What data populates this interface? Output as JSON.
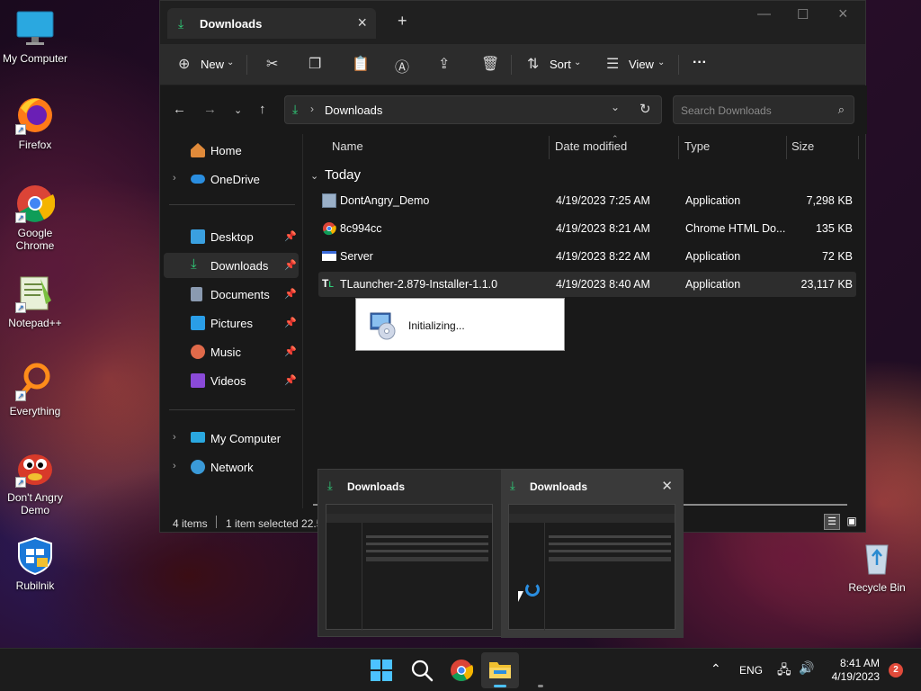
{
  "desktop": {
    "icons": [
      {
        "label": "My Computer"
      },
      {
        "label": "Firefox"
      },
      {
        "label": "Google Chrome"
      },
      {
        "label": "Notepad++"
      },
      {
        "label": "Everything"
      },
      {
        "label": "Don't Angry Demo"
      },
      {
        "label": "Rubilnik"
      },
      {
        "label": "Recycle Bin"
      }
    ]
  },
  "explorer": {
    "tab_title": "Downloads",
    "new_tab": "+",
    "toolbar": {
      "new_label": "New",
      "sort_label": "Sort",
      "view_label": "View",
      "more": "···"
    },
    "address": {
      "path": "Downloads"
    },
    "search": {
      "placeholder": "Search Downloads"
    },
    "sidebar": {
      "home": "Home",
      "onedrive": "OneDrive",
      "desktop": "Desktop",
      "downloads": "Downloads",
      "documents": "Documents",
      "pictures": "Pictures",
      "music": "Music",
      "videos": "Videos",
      "mycomputer": "My Computer",
      "network": "Network"
    },
    "columns": {
      "name": "Name",
      "date": "Date modified",
      "type": "Type",
      "size": "Size"
    },
    "group": "Today",
    "files": [
      {
        "name": "DontAngry_Demo",
        "date": "4/19/2023 7:25 AM",
        "type": "Application",
        "size": "7,298 KB"
      },
      {
        "name": "8c994cc",
        "date": "4/19/2023 8:21 AM",
        "type": "Chrome HTML Do...",
        "size": "135 KB"
      },
      {
        "name": "Server",
        "date": "4/19/2023 8:22 AM",
        "type": "Application",
        "size": "72 KB"
      },
      {
        "name": "TLauncher-2.879-Installer-1.1.0",
        "date": "4/19/2023 8:40 AM",
        "type": "Application",
        "size": "23,117 KB"
      }
    ],
    "status": {
      "items": "4 items",
      "selected": "1 item selected 22.5"
    }
  },
  "popup": {
    "text": "Initializing..."
  },
  "thumbnails": [
    {
      "title": "Downloads"
    },
    {
      "title": "Downloads"
    }
  ],
  "taskbar": {
    "lang": "ENG",
    "time": "8:41 AM",
    "date": "4/19/2023",
    "notifications": "2"
  },
  "colors": {
    "accent": "#2fd07a",
    "window_bg": "#191919",
    "selection": "#2d2d2d"
  }
}
